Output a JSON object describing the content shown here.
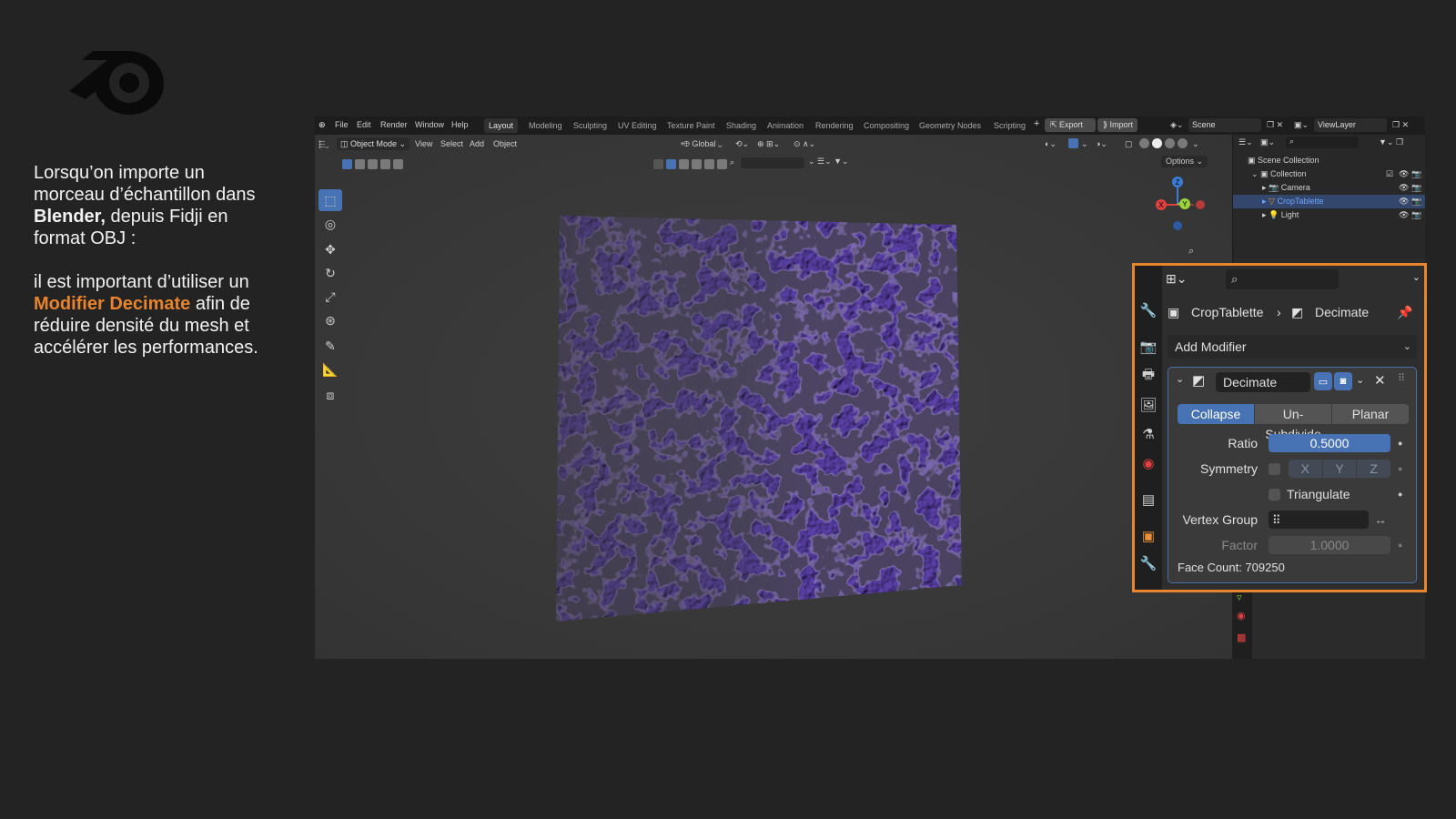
{
  "slide": {
    "caption_line1_a": "Lorsqu’on importe un morceau d’échantillon dans ",
    "caption_line1_bold": "Blender,",
    "caption_line1_b": " depuis Fidji en format OBJ :",
    "caption_line2_a": "il est important d’utiliser un ",
    "caption_line2_highlight": "Modifier Decimate",
    "caption_line2_b": " afin de réduire densité du mesh et accélérer les performances.",
    "highlight_color": "#e8832e"
  },
  "topbar": {
    "menus": [
      "File",
      "Edit",
      "Render",
      "Window",
      "Help"
    ],
    "workspaces": [
      "Layout",
      "Modeling",
      "Sculpting",
      "UV Editing",
      "Texture Paint",
      "Shading",
      "Animation",
      "Rendering",
      "Compositing",
      "Geometry Nodes",
      "Scripting"
    ],
    "export_label": "Export",
    "import_label": "Import",
    "scene": "Scene",
    "view_layer": "ViewLayer"
  },
  "viewport": {
    "mode": "Object Mode",
    "menus": [
      "View",
      "Select",
      "Add",
      "Object"
    ],
    "transform": "Global",
    "options": "Options",
    "mesh_color": "#6a52a8"
  },
  "outliner": {
    "root": "Scene Collection",
    "collection": "Collection",
    "items": [
      "Camera",
      "CropTablette",
      "Light"
    ]
  },
  "properties": {
    "object": "CropTablette",
    "modifier": "Decimate",
    "add_modifier": "Add Modifier",
    "modifier_name": "Decimate",
    "modes": [
      "Collapse",
      "Un-Subdivide",
      "Planar"
    ],
    "ratio_label": "Ratio",
    "ratio_value": "0.5000",
    "symmetry_label": "Symmetry",
    "axes": [
      "X",
      "Y",
      "Z"
    ],
    "triangulate_label": "Triangulate",
    "vertex_group_label": "Vertex Group",
    "factor_label": "Factor",
    "factor_value": "1.0000",
    "face_count": "Face Count: 709250"
  }
}
